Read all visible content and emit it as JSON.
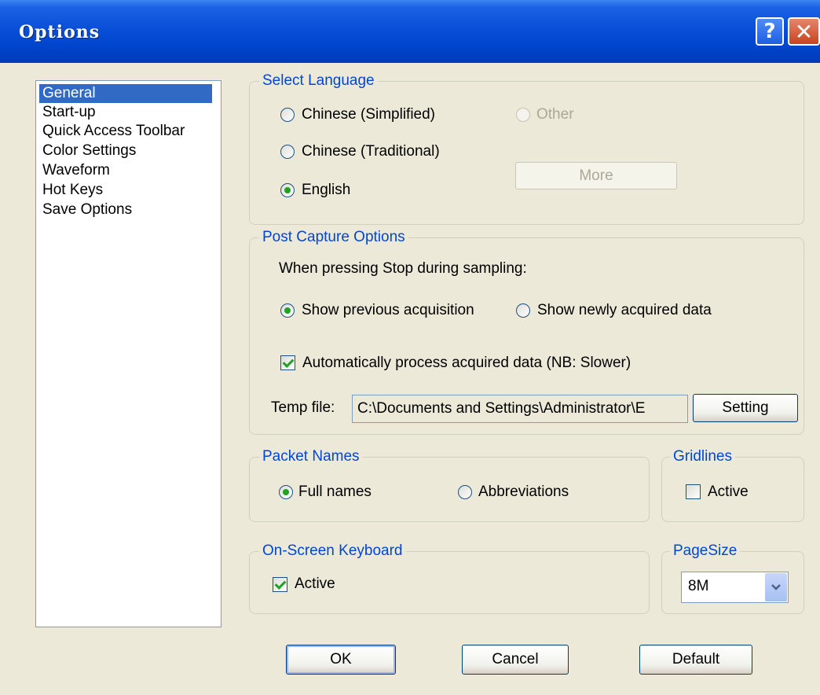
{
  "window": {
    "title": "Options"
  },
  "titlebar": {
    "help_glyph": "?",
    "close_glyph": "✕"
  },
  "nav": {
    "items": [
      {
        "label": "General",
        "selected": true
      },
      {
        "label": "Start-up"
      },
      {
        "label": "Quick Access Toolbar"
      },
      {
        "label": "Color Settings"
      },
      {
        "label": "Waveform"
      },
      {
        "label": "Hot Keys"
      },
      {
        "label": "Save Options"
      }
    ]
  },
  "language": {
    "legend": "Select Language",
    "options": [
      "Chinese (Simplified)",
      "Chinese (Traditional)",
      "English",
      "Other"
    ],
    "selected": "English",
    "more_button": "More"
  },
  "post_capture": {
    "legend": "Post Capture Options",
    "prompt": "When pressing Stop during sampling:",
    "options": [
      "Show previous acquisition",
      "Show newly acquired data"
    ],
    "selected": "Show previous acquisition",
    "auto_process_label": "Automatically process acquired data (NB: Slower)",
    "auto_process_checked": true,
    "temp_file_label": "Temp file:",
    "temp_file_value": "C:\\Documents and Settings\\Administrator\\E",
    "setting_button": "Setting"
  },
  "packet_names": {
    "legend": "Packet Names",
    "options": [
      "Full names",
      "Abbreviations"
    ],
    "selected": "Full names"
  },
  "gridlines": {
    "legend": "Gridlines",
    "active_label": "Active",
    "active_checked": false
  },
  "keyboard": {
    "legend": "On-Screen Keyboard",
    "active_label": "Active",
    "active_checked": true
  },
  "pagesize": {
    "legend": "PageSize",
    "value": "8M"
  },
  "footer": {
    "ok": "OK",
    "cancel": "Cancel",
    "default": "Default"
  },
  "colors": {
    "titlebar": "#0a4fd8",
    "selection": "#316ac5",
    "legend": "#0046d5",
    "dialog_bg": "#ece9d8"
  }
}
